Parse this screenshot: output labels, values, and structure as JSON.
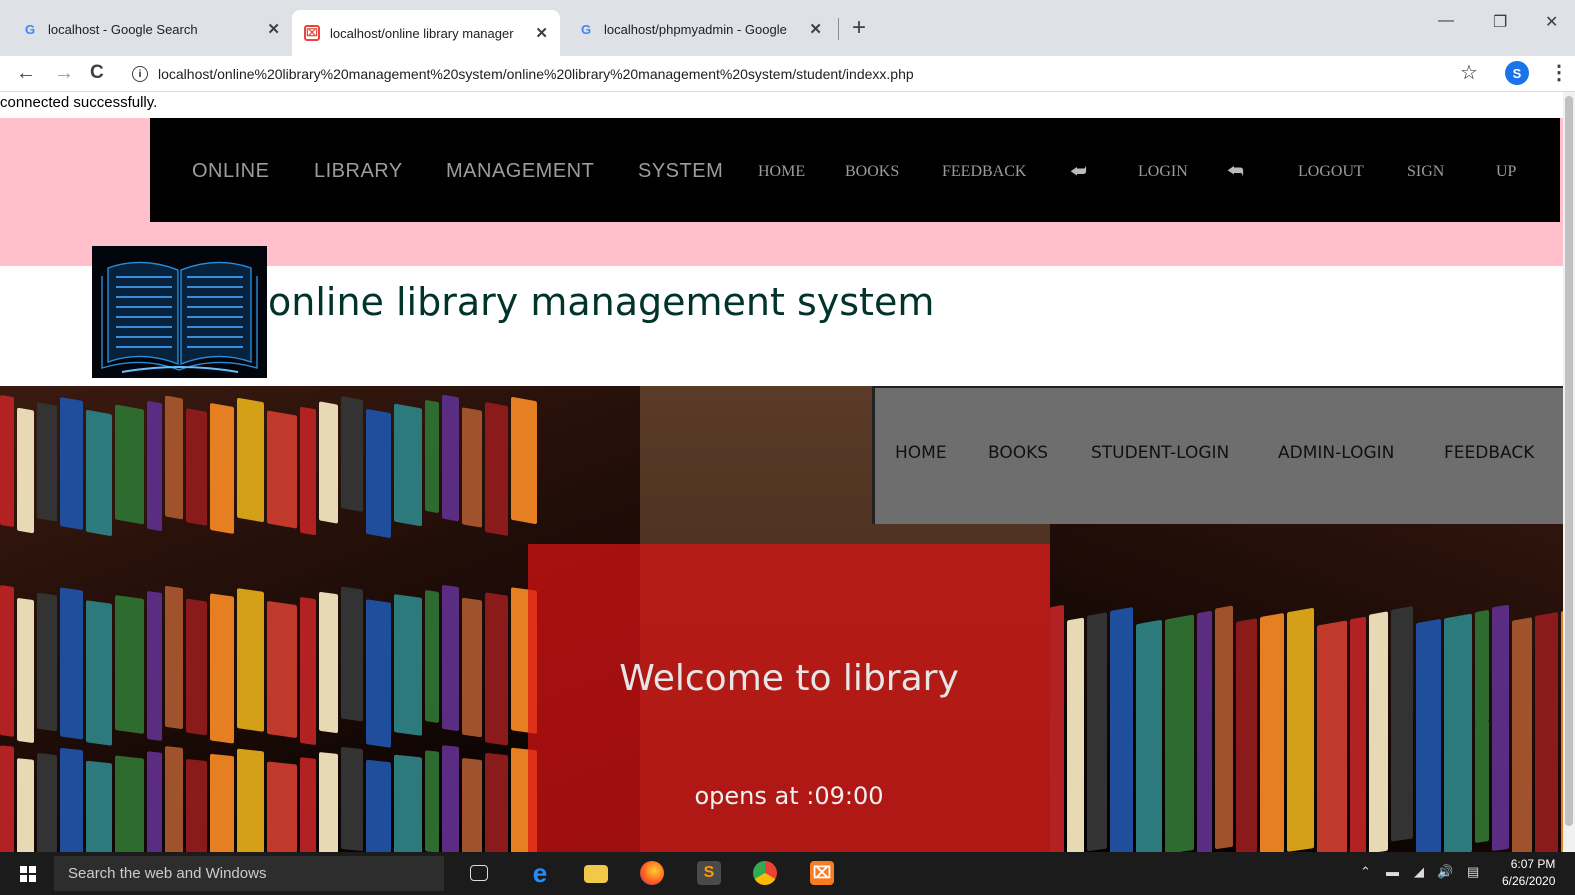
{
  "browser": {
    "tabs": [
      {
        "title": "localhost - Google Search",
        "favicon": "google-icon"
      },
      {
        "title": "localhost/online library manager",
        "favicon": "xampp-icon"
      },
      {
        "title": "localhost/phpmyadmin - Google",
        "favicon": "google-icon"
      }
    ],
    "close_glyph": "✕",
    "new_tab_glyph": "+",
    "url": "localhost/online%20library%20management%20system/online%20library%20management%20system/student/indexx.php",
    "profile_initial": "S"
  },
  "page": {
    "status_message": "connected successfully.",
    "top_nav": {
      "items": [
        "ONLINE",
        "LIBRARY",
        "MANAGEMENT",
        "SYSTEM",
        "HOME",
        "BOOKS",
        "FEEDBACK",
        "LOGIN",
        "LOGOUT",
        "SIGN",
        "UP"
      ],
      "login_icon": "login-icon",
      "logout_icon": "logout-icon"
    },
    "site_title": "online library management system",
    "sub_nav": {
      "items": [
        "HOME",
        "BOOKS",
        "STUDENT-LOGIN",
        "ADMIN-LOGIN",
        "FEEDBACK"
      ]
    },
    "welcome": {
      "title": "Welcome to library",
      "opens": "opens at :09:00"
    },
    "colors": {
      "pink_band": "#ffc0cb",
      "nav_bg": "#000000",
      "subnav_bg": "#6e6e6e",
      "welcome_bg": "#dc1414"
    }
  },
  "taskbar": {
    "search_placeholder": "Search the web and Windows",
    "time": "6:07 PM",
    "date": "6/26/2020",
    "apps": [
      "task-view-icon",
      "edge-icon",
      "file-explorer-icon",
      "firefox-icon",
      "sublime-icon",
      "chrome-icon",
      "xampp-icon"
    ]
  }
}
